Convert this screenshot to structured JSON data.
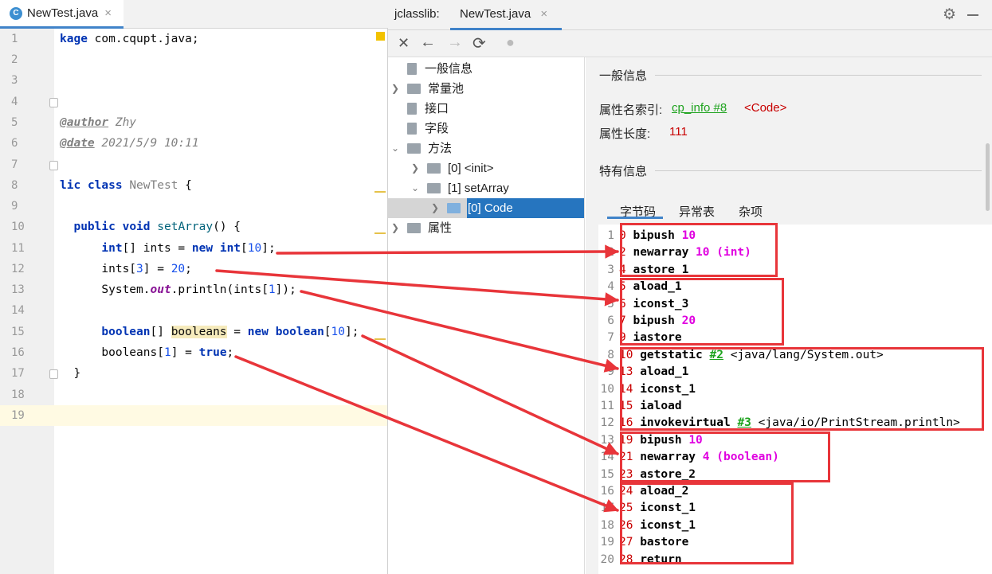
{
  "editor": {
    "tab": {
      "icon": "C",
      "name": "NewTest.java",
      "close": "×"
    },
    "lines": [
      {
        "n": "1"
      },
      {
        "n": "2"
      },
      {
        "n": "3"
      },
      {
        "n": "4"
      },
      {
        "n": "5"
      },
      {
        "n": "6"
      },
      {
        "n": "7"
      },
      {
        "n": "8"
      },
      {
        "n": "9"
      },
      {
        "n": "10"
      },
      {
        "n": "11"
      },
      {
        "n": "12"
      },
      {
        "n": "13"
      },
      {
        "n": "14"
      },
      {
        "n": "15"
      },
      {
        "n": "16"
      },
      {
        "n": "17"
      },
      {
        "n": "18"
      },
      {
        "n": "19"
      }
    ],
    "code": {
      "l1_kw": "kage",
      "l1_rest": " com.cqupt.java;",
      "l5_tag": "@author",
      "l5_rest": " Zhy",
      "l6_tag": "@date",
      "l6_rest": " 2021/5/9 10:11",
      "l8_kw1": "lic",
      "l8_kw2": "class",
      "l8_cls": "NewTest",
      "l8_rest": " {",
      "l10_kw1": "public",
      "l10_kw2": "void",
      "l10_fn": "setArray",
      "l10_rest": "() {",
      "l11_a": "int",
      "l11_b": "[] ints = ",
      "l11_c": "new",
      "l11_d": "int",
      "l11_e": "[",
      "l11_f": "10",
      "l11_g": "];",
      "l12_a": "ints[",
      "l12_b": "3",
      "l12_c": "] = ",
      "l12_d": "20",
      "l12_e": ";",
      "l13_a": "System.",
      "l13_b": "out",
      "l13_c": ".println(ints[",
      "l13_d": "1",
      "l13_e": "]);",
      "l15_a": "boolean",
      "l15_b": "[] ",
      "l15_c": "booleans",
      "l15_d": " = ",
      "l15_e": "new",
      "l15_f": "boolean",
      "l15_g": "[",
      "l15_h": "10",
      "l15_i": "];",
      "l16_a": "booleans[",
      "l16_b": "1",
      "l16_c": "] = ",
      "l16_d": "true",
      "l16_e": ";",
      "l17": "}"
    }
  },
  "jclasslib": {
    "app_label": "jclasslib:",
    "tab": "NewTest.java",
    "close": "×",
    "toolbar": {
      "close": "✕",
      "back": "←",
      "forward": "→",
      "refresh": "⟳",
      "web": "●"
    },
    "tree": {
      "general": "一般信息",
      "constant_pool": "常量池",
      "interfaces": "接口",
      "fields": "字段",
      "methods": "方法",
      "init": "[0] <init>",
      "setArray": "[1] setArray",
      "code": "[0] Code",
      "attributes": "属性"
    },
    "detail": {
      "general_title": "一般信息",
      "name_index_label": "属性名索引:",
      "name_index_link": "cp_info #8",
      "name_index_value": "<Code>",
      "length_label": "属性长度:",
      "length_value": "111",
      "specific_title": "特有信息",
      "tabs": [
        "字节码",
        "异常表",
        "杂项"
      ]
    },
    "bytecode": [
      {
        "line": "1",
        "offset": "0",
        "op": "bipush",
        "arg": "10"
      },
      {
        "line": "2",
        "offset": "2",
        "op": "newarray",
        "arg": "10 (int)"
      },
      {
        "line": "3",
        "offset": "4",
        "op": "astore_1"
      },
      {
        "line": "4",
        "offset": "5",
        "op": "aload_1"
      },
      {
        "line": "5",
        "offset": "6",
        "op": "iconst_3"
      },
      {
        "line": "6",
        "offset": "7",
        "op": "bipush",
        "arg": "20"
      },
      {
        "line": "7",
        "offset": "9",
        "op": "iastore"
      },
      {
        "line": "8",
        "offset": "10",
        "op": "getstatic",
        "ref": "#2",
        "comment": "<java/lang/System.out>"
      },
      {
        "line": "9",
        "offset": "13",
        "op": "aload_1"
      },
      {
        "line": "10",
        "offset": "14",
        "op": "iconst_1"
      },
      {
        "line": "11",
        "offset": "15",
        "op": "iaload"
      },
      {
        "line": "12",
        "offset": "16",
        "op": "invokevirtual",
        "ref": "#3",
        "comment": "<java/io/PrintStream.println>"
      },
      {
        "line": "13",
        "offset": "19",
        "op": "bipush",
        "arg": "10"
      },
      {
        "line": "14",
        "offset": "21",
        "op": "newarray",
        "arg": "4 (boolean)"
      },
      {
        "line": "15",
        "offset": "23",
        "op": "astore_2"
      },
      {
        "line": "16",
        "offset": "24",
        "op": "aload_2"
      },
      {
        "line": "17",
        "offset": "25",
        "op": "iconst_1"
      },
      {
        "line": "18",
        "offset": "26",
        "op": "iconst_1"
      },
      {
        "line": "19",
        "offset": "27",
        "op": "bastore"
      },
      {
        "line": "20",
        "offset": "28",
        "op": "return"
      }
    ]
  },
  "colors": {
    "annotation_red": "#e8353a",
    "selection_blue": "#2675bf",
    "link_green": "#1ea31e",
    "operand_magenta": "#e000e0",
    "offset_red": "#c80000"
  }
}
